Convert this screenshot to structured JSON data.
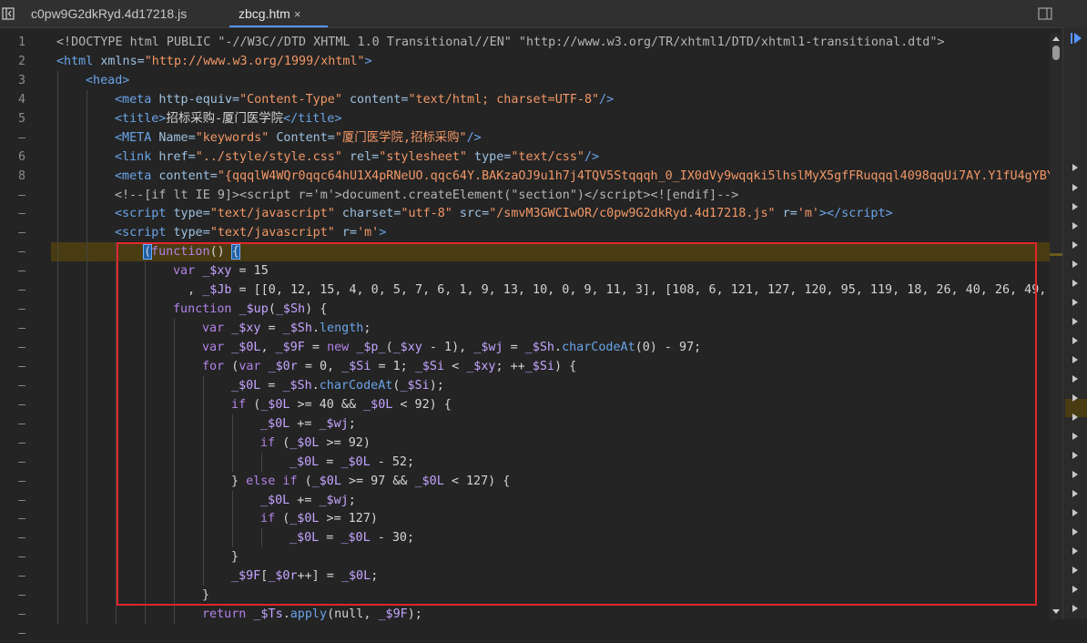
{
  "tabs": [
    {
      "label": "c0pw9G2dkRyd.4d17218.js"
    },
    {
      "label": "zbcg.htm",
      "close": "×"
    }
  ],
  "gutter": [
    "1",
    "2",
    "3",
    "4",
    "5",
    "–",
    "6",
    "8",
    "–",
    "–",
    "–",
    "–",
    "–",
    "–",
    "–",
    "–",
    "–",
    "–",
    "–",
    "–",
    "–",
    "–",
    "–",
    "–",
    "–",
    "–",
    "–",
    "–",
    "–",
    "–",
    "–",
    "–"
  ],
  "colors": {
    "highlight": "#4a3c12",
    "annotation_box": "#e0262b",
    "tab_active_underline": "#5794ff"
  },
  "icons": [
    "panel-toggle-icon",
    "close-icon",
    "split-panel-icon",
    "scroll-up-icon",
    "scroll-down-icon",
    "expand-triangle-icon"
  ]
}
